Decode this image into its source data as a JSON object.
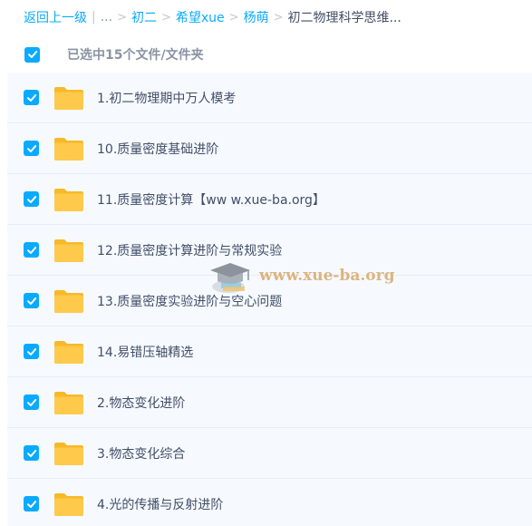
{
  "breadcrumb": {
    "back_label": "返回上一级",
    "ellipsis": "...",
    "items": [
      "初二",
      "希望xue",
      "杨萌"
    ],
    "current": "初二物理科学思维..."
  },
  "selection": {
    "text": "已选中15个文件/文件夹"
  },
  "files": [
    {
      "name": "1.初二物理期中万人模考"
    },
    {
      "name": "10.质量密度基础进阶"
    },
    {
      "name": "11.质量密度计算【ww w.xue-ba.org】"
    },
    {
      "name": "12.质量密度计算进阶与常规实验"
    },
    {
      "name": "13.质量密度实验进阶与空心问题"
    },
    {
      "name": "14.易错压轴精选"
    },
    {
      "name": "2.物态变化进阶"
    },
    {
      "name": "3.物态变化综合"
    },
    {
      "name": "4.光的传播与反射进阶"
    }
  ],
  "watermark": {
    "text": "www.xue-ba.org"
  },
  "colors": {
    "accent": "#09aaff",
    "folder": "#ffc94b",
    "row_bg": "#f6faff",
    "text": "#424e67"
  },
  "icons": {
    "checkbox": "check-icon",
    "folder": "folder-icon",
    "watermark": "graduation-cap-icon"
  }
}
